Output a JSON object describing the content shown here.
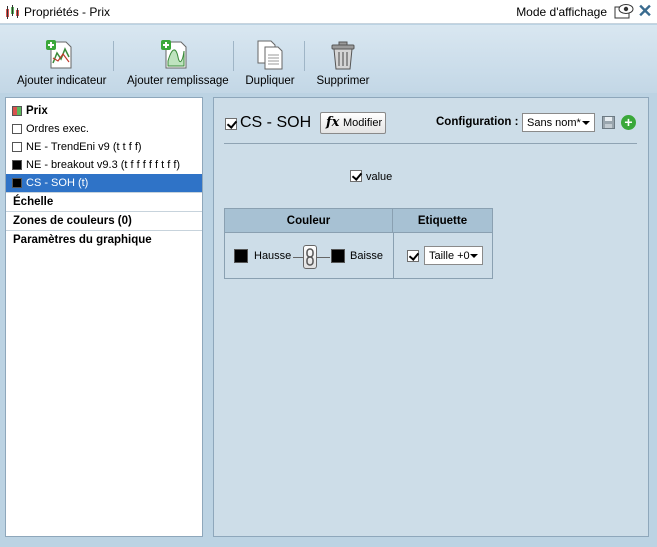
{
  "window": {
    "title": "Propriétés - Prix",
    "mode_label": "Mode d'affichage",
    "close_symbol": "✕"
  },
  "toolbar": {
    "add_indicator": "Ajouter indicateur",
    "add_fill": "Ajouter remplissage",
    "duplicate": "Dupliquer",
    "delete": "Supprimer"
  },
  "tree": {
    "items": [
      {
        "label": "Prix",
        "swatch": "#d9534f"
      },
      {
        "label": "Ordres exec.",
        "swatch": "#ffffff"
      },
      {
        "label": "NE - TrendEni v9 (t t f f)",
        "swatch": "#ffffff"
      },
      {
        "label": "NE - breakout v9.3 (t f f f f f t f f)",
        "swatch": "#000000"
      },
      {
        "label": "CS - SOH (t)",
        "swatch": "#000000"
      }
    ],
    "sections": [
      "Échelle",
      "Zones de couleurs (0)",
      "Paramètres du graphique"
    ]
  },
  "editor": {
    "indicator_name": "CS - SOH",
    "modify_label": "Modifier",
    "fx_symbol": "fx",
    "config_label": "Configuration :",
    "config_value": "Sans nom*",
    "add_symbol": "+",
    "value_label": "value",
    "table": {
      "col_color": "Couleur",
      "col_label": "Etiquette",
      "up_label": "Hausse",
      "down_label": "Baisse",
      "size_value": "Taille +0"
    }
  },
  "colors": {
    "selected_row": "#2f73c7",
    "panel_bg": "#cddde8",
    "header_bg": "#a7c1d3",
    "add_green": "#3aa83a"
  }
}
